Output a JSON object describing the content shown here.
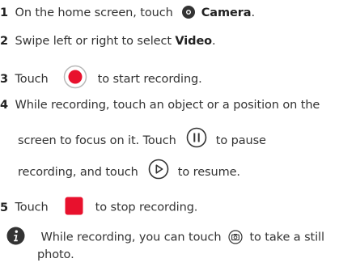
{
  "steps": [
    {
      "number": "1",
      "text_a": "On the home screen, touch",
      "app_name": "Camera",
      "text_b": "."
    },
    {
      "number": "2",
      "text_a": "Swipe left or right to select",
      "mode_name": "Video",
      "text_b": "."
    },
    {
      "number": "3",
      "text_a": "Touch",
      "text_b": "to start recording."
    },
    {
      "number": "4",
      "line1": "While recording, touch an object or a position on the",
      "line2_a": "screen to focus on it. Touch",
      "line2_b": "to pause",
      "line3_a": "recording, and touch",
      "line3_b": "to resume."
    },
    {
      "number": "5",
      "text_a": "Touch",
      "text_b": "to stop recording."
    }
  ],
  "note": {
    "line1_a": "While recording, you can touch",
    "line1_b": "to take a still",
    "line2": "photo."
  },
  "colors": {
    "record_red": "#e8112d",
    "icon_dark": "#333333",
    "info_icon": "#333333"
  },
  "icons": {
    "camera": "camera-app-icon",
    "record": "record-button-icon",
    "pause": "pause-button-icon",
    "resume": "resume-button-icon",
    "stop": "stop-button-icon",
    "snapshot": "snapshot-camera-icon",
    "info": "info-icon"
  }
}
